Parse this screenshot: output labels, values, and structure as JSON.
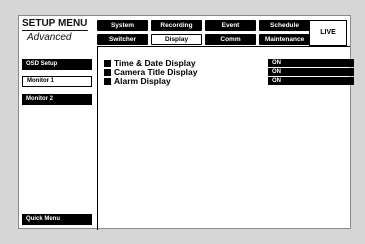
{
  "header": {
    "title": "SETUP MENU",
    "subtitle": "Advanced"
  },
  "tabs_top": [
    {
      "label": "System"
    },
    {
      "label": "Recording"
    },
    {
      "label": "Event"
    },
    {
      "label": "Schedule"
    }
  ],
  "tabs_bottom": [
    {
      "label": "Switcher"
    },
    {
      "label": "Display"
    },
    {
      "label": "Comm"
    },
    {
      "label": "Maintenance"
    }
  ],
  "live_label": "LIVE",
  "sidebar": {
    "items": [
      {
        "label": "OSD Setup"
      },
      {
        "label": "Monitor 1"
      },
      {
        "label": "Monitor 2"
      }
    ],
    "quick_menu": "Quick Menu"
  },
  "settings": [
    {
      "label": "Time & Date Display",
      "value": "ON"
    },
    {
      "label": "Camera Title Display",
      "value": "ON"
    },
    {
      "label": "Alarm Display",
      "value": "ON"
    }
  ],
  "colors": {
    "background": "#d6d6d6",
    "panel": "#ffffff",
    "button": "#000000",
    "button_text": "#ffffff"
  }
}
